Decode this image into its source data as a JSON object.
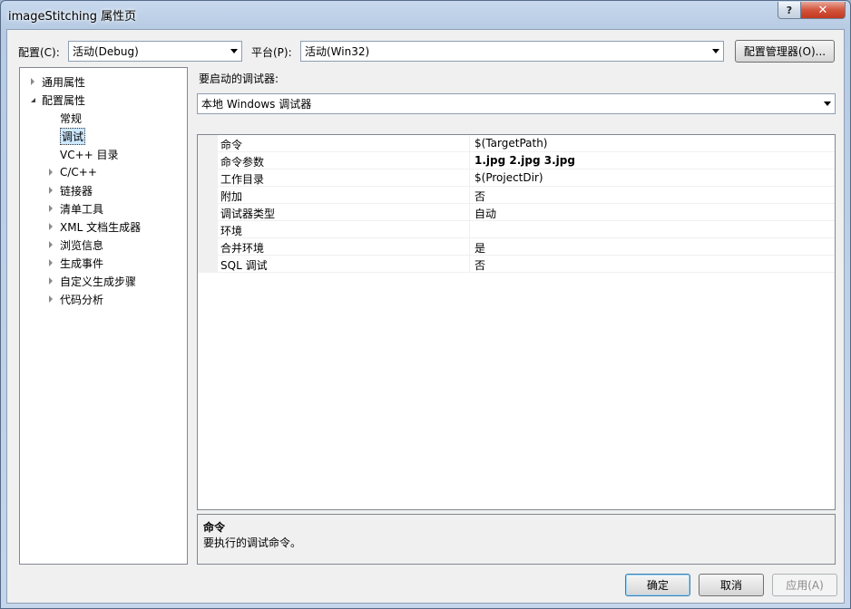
{
  "window": {
    "title": "imageStitching 属性页",
    "help_glyph": "?",
    "close_glyph": "✕"
  },
  "toolbar": {
    "config_label": "配置(C):",
    "config_value": "活动(Debug)",
    "platform_label": "平台(P):",
    "platform_value": "活动(Win32)",
    "config_manager_button": "配置管理器(O)..."
  },
  "tree": {
    "items": [
      {
        "label": "通用属性",
        "level": 0,
        "expander": "closed"
      },
      {
        "label": "配置属性",
        "level": 0,
        "expander": "open"
      },
      {
        "label": "常规",
        "level": 1,
        "expander": "none"
      },
      {
        "label": "调试",
        "level": 1,
        "expander": "none",
        "selected": true
      },
      {
        "label": "VC++ 目录",
        "level": 1,
        "expander": "none"
      },
      {
        "label": "C/C++",
        "level": 1,
        "expander": "closed"
      },
      {
        "label": "链接器",
        "level": 1,
        "expander": "closed"
      },
      {
        "label": "清单工具",
        "level": 1,
        "expander": "closed"
      },
      {
        "label": "XML 文档生成器",
        "level": 1,
        "expander": "closed"
      },
      {
        "label": "浏览信息",
        "level": 1,
        "expander": "closed"
      },
      {
        "label": "生成事件",
        "level": 1,
        "expander": "closed"
      },
      {
        "label": "自定义生成步骤",
        "level": 1,
        "expander": "closed"
      },
      {
        "label": "代码分析",
        "level": 1,
        "expander": "closed"
      }
    ]
  },
  "debugger": {
    "label": "要启动的调试器:",
    "value": "本地 Windows 调试器"
  },
  "properties": [
    {
      "name": "命令",
      "value": "$(TargetPath)",
      "bold": false
    },
    {
      "name": "命令参数",
      "value": "1.jpg 2.jpg 3.jpg",
      "bold": true
    },
    {
      "name": "工作目录",
      "value": "$(ProjectDir)",
      "bold": false
    },
    {
      "name": "附加",
      "value": "否",
      "bold": false
    },
    {
      "name": "调试器类型",
      "value": "自动",
      "bold": false
    },
    {
      "name": "环境",
      "value": "",
      "bold": false
    },
    {
      "name": "合并环境",
      "value": "是",
      "bold": false
    },
    {
      "name": "SQL 调试",
      "value": "否",
      "bold": false
    }
  ],
  "description": {
    "title": "命令",
    "text": "要执行的调试命令。"
  },
  "footer": {
    "ok": "确定",
    "cancel": "取消",
    "apply": "应用(A)"
  }
}
